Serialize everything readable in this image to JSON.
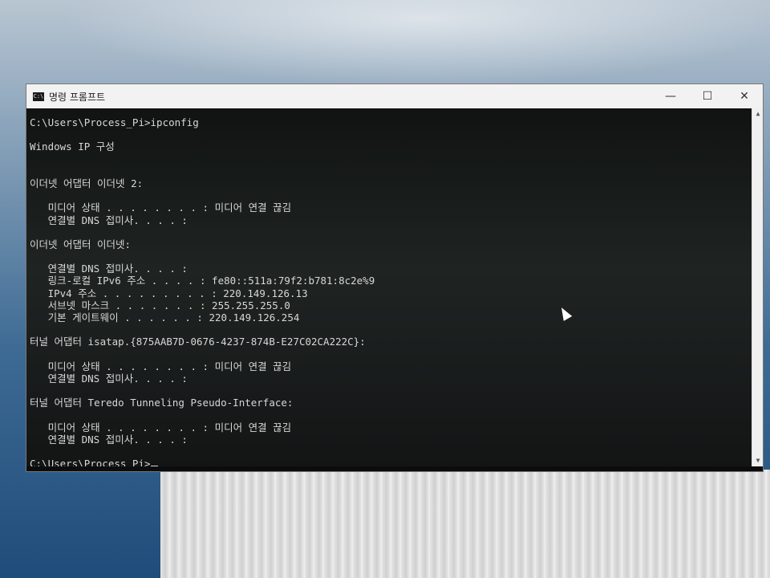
{
  "window": {
    "title": "명령 프롬프트",
    "icon_label": "C:\\",
    "controls": {
      "minimize": "—",
      "maximize": "☐",
      "close": "✕"
    }
  },
  "console": {
    "lines": [
      "C:\\Users\\Process_Pi>ipconfig",
      "",
      "Windows IP 구성",
      "",
      "",
      "이더넷 어댑터 이더넷 2:",
      "",
      "   미디어 상태 . . . . . . . . : 미디어 연결 끊김",
      "   연결별 DNS 접미사. . . . :",
      "",
      "이더넷 어댑터 이더넷:",
      "",
      "   연결별 DNS 접미사. . . . :",
      "   링크-로컬 IPv6 주소 . . . . : fe80::511a:79f2:b781:8c2e%9",
      "   IPv4 주소 . . . . . . . . . : 220.149.126.13",
      "   서브넷 마스크 . . . . . . . : 255.255.255.0",
      "   기본 게이트웨이 . . . . . . : 220.149.126.254",
      "",
      "터널 어댑터 isatap.{875AAB7D-0676-4237-874B-E27C02CA222C}:",
      "",
      "   미디어 상태 . . . . . . . . : 미디어 연결 끊김",
      "   연결별 DNS 접미사. . . . :",
      "",
      "터널 어댑터 Teredo Tunneling Pseudo-Interface:",
      "",
      "   미디어 상태 . . . . . . . . : 미디어 연결 끊김",
      "   연결별 DNS 접미사. . . . :",
      ""
    ],
    "prompt": "C:\\Users\\Process_Pi>"
  },
  "scrollbar": {
    "up_arrow": "▲",
    "down_arrow": "▼"
  }
}
